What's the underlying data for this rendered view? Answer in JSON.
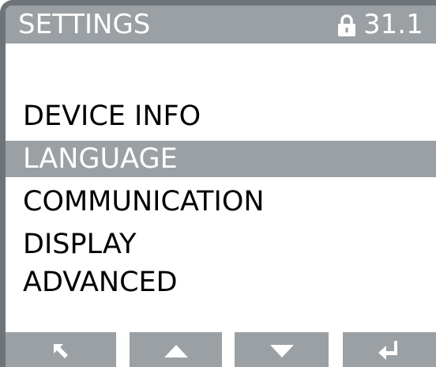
{
  "header": {
    "title": "SETTINGS",
    "value": "31.1",
    "lock_icon": "lock-icon"
  },
  "menu": {
    "selected_index": 1,
    "items": [
      {
        "label": "DEVICE INFO"
      },
      {
        "label": "LANGUAGE"
      },
      {
        "label": "COMMUNICATION"
      },
      {
        "label": "DISPLAY"
      },
      {
        "label": "ADVANCED"
      }
    ]
  },
  "softkeys": [
    {
      "icon": "back-arrow-icon"
    },
    {
      "icon": "up-arrow-icon"
    },
    {
      "icon": "down-arrow-icon"
    },
    {
      "icon": "enter-icon"
    }
  ],
  "colors": {
    "bar": "#9ba0a4",
    "frame": "#6f7478",
    "background": "#ffffff",
    "text": "#000000",
    "selected_text": "#ffffff"
  }
}
